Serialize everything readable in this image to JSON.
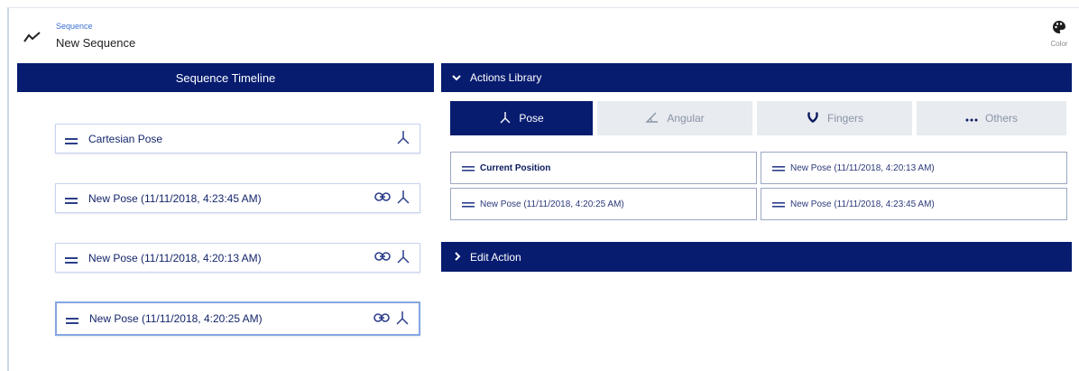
{
  "header": {
    "caption": "Sequence",
    "name": "New Sequence",
    "color_label": "Color"
  },
  "timeline": {
    "title": "Sequence Timeline",
    "items": [
      {
        "label": "Cartesian Pose"
      },
      {
        "label": "New Pose (11/11/2018, 4:23:45 AM)"
      },
      {
        "label": "New Pose (11/11/2018, 4:20:13 AM)"
      },
      {
        "label": "New Pose (11/11/2018, 4:20:25 AM)"
      }
    ]
  },
  "library": {
    "title": "Actions Library",
    "tabs": [
      {
        "label": "Pose",
        "icon": "pose-icon"
      },
      {
        "label": "Angular",
        "icon": "angle-icon"
      },
      {
        "label": "Fingers",
        "icon": "gripper-icon"
      },
      {
        "label": "Others",
        "icon": "more-icon"
      }
    ],
    "poses": [
      {
        "label": "Current Position"
      },
      {
        "label": "New Pose (11/11/2018, 4:20:13 AM)"
      },
      {
        "label": "New Pose (11/11/2018, 4:20:25 AM)"
      },
      {
        "label": "New Pose (11/11/2018, 4:23:45 AM)"
      }
    ]
  },
  "edit": {
    "title": "Edit Action"
  },
  "colors": {
    "accent": "#071c6f",
    "tab_inactive": "#e8ebef"
  }
}
